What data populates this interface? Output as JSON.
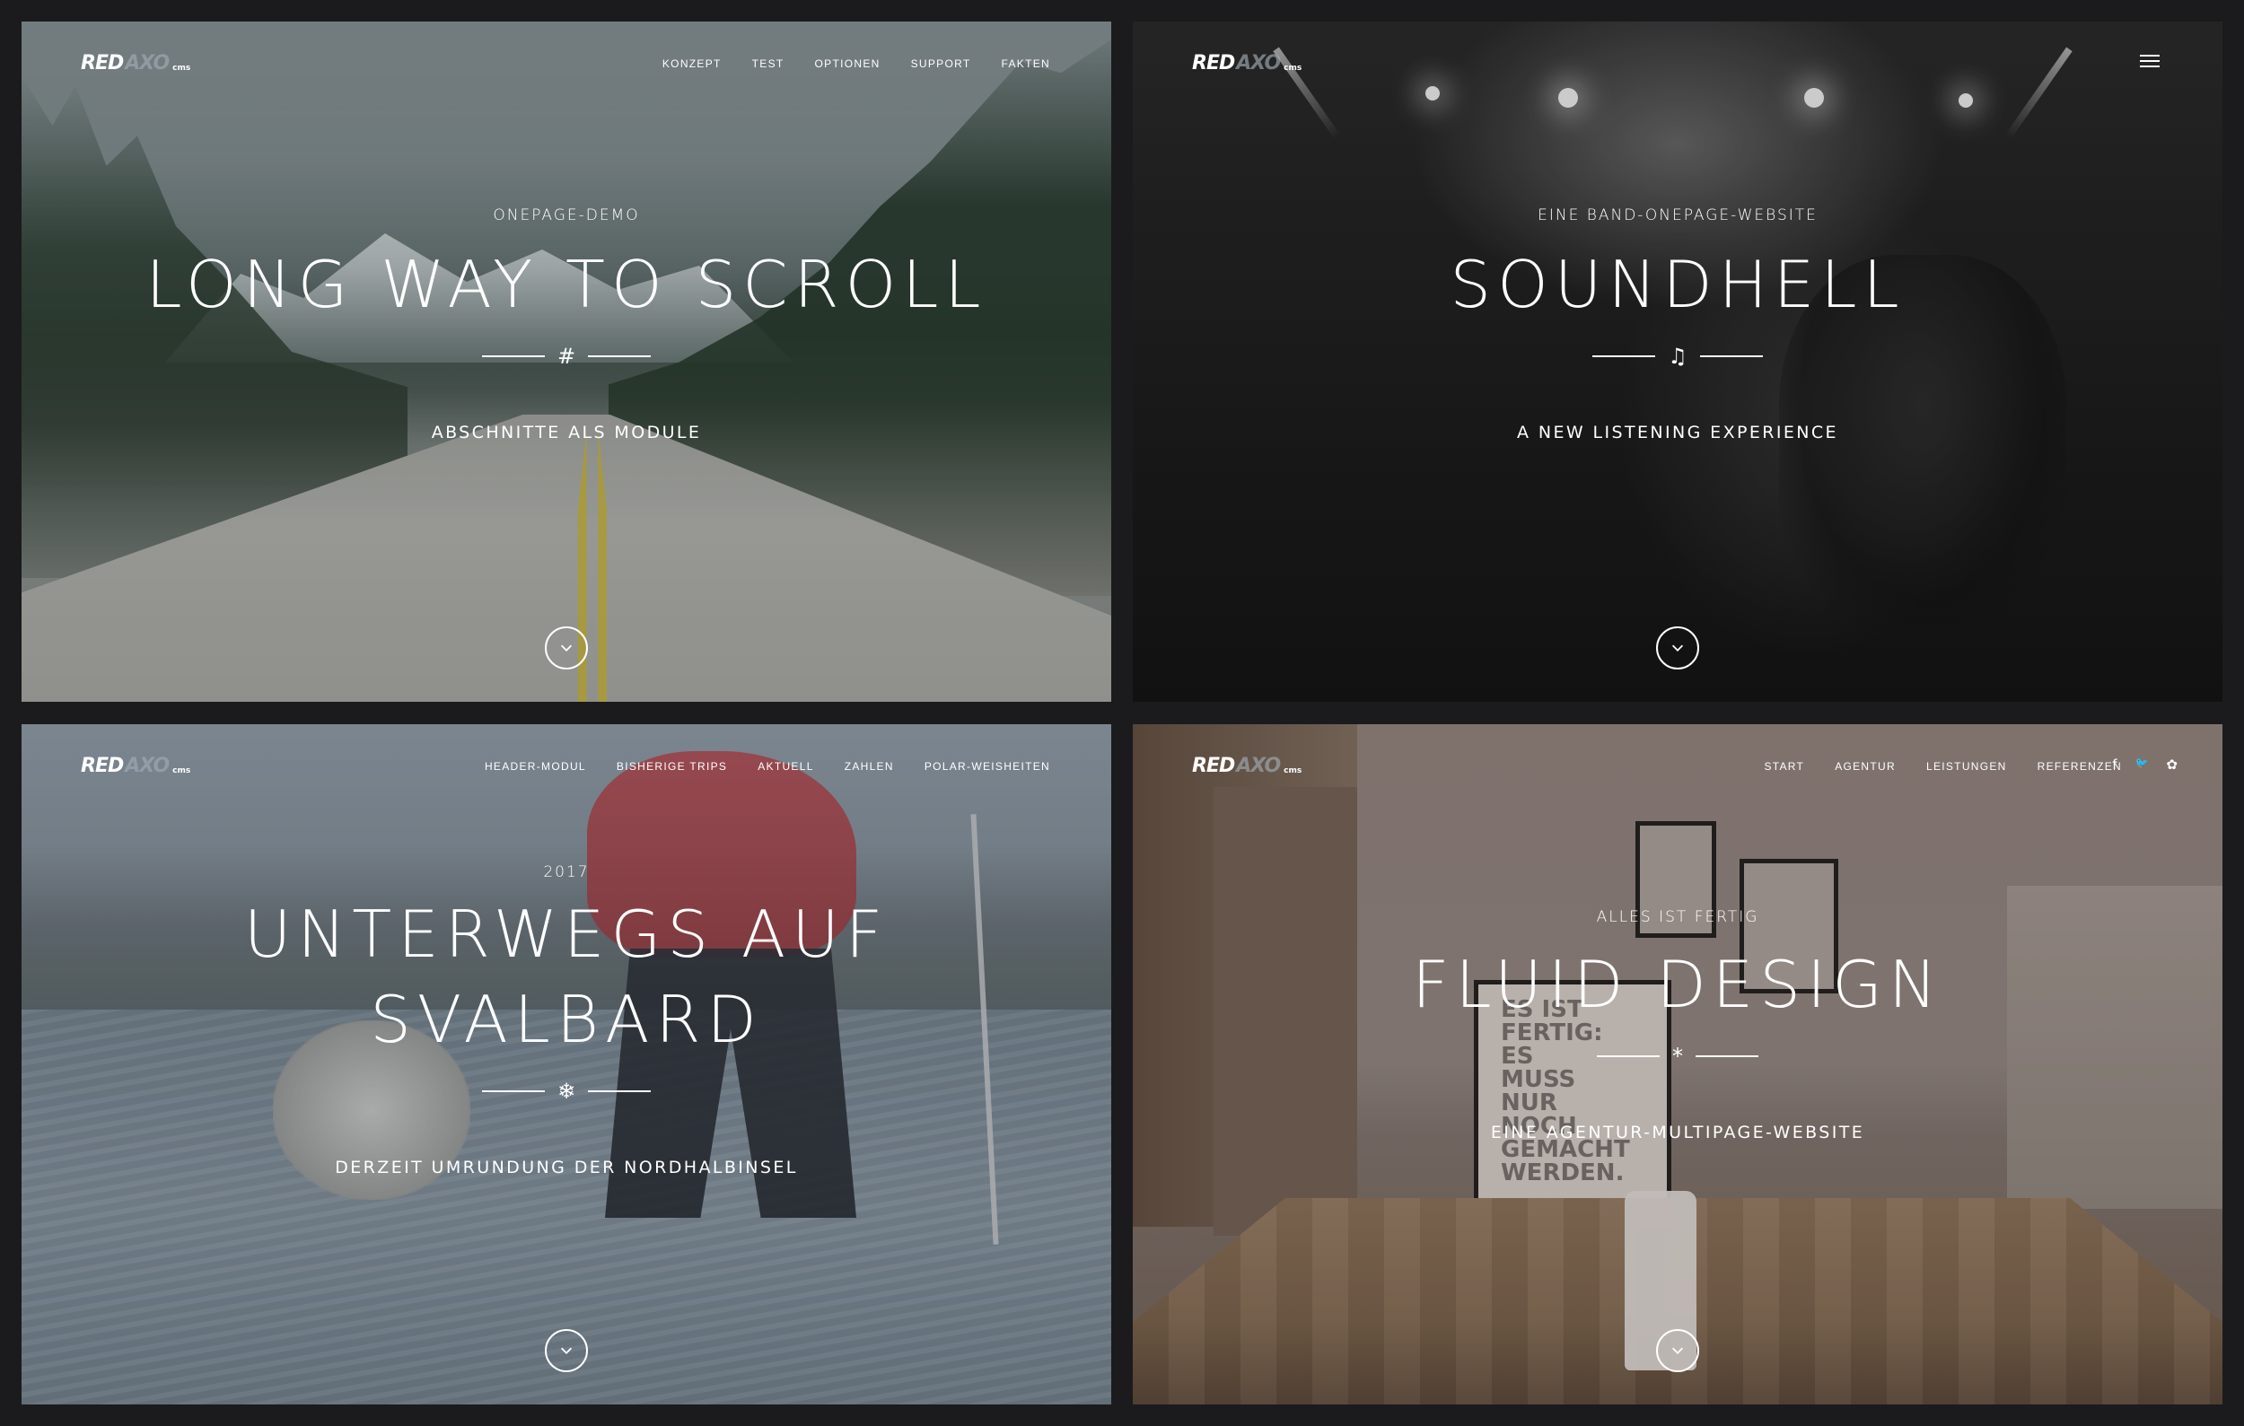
{
  "panels": [
    {
      "logo": {
        "red": "RED",
        "axo": "AXO",
        "cms": "cms"
      },
      "nav": [
        "KONZEPT",
        "TEST",
        "OPTIONEN",
        "SUPPORT",
        "FAKTEN"
      ],
      "eyebrow": "ONEPAGE-DEMO",
      "headline": [
        "LONG WAY TO SCROLL"
      ],
      "divider_glyph": "#",
      "tagline": "ABSCHNITTE ALS MODULE",
      "scroll_icon": "chevron-down-icon"
    },
    {
      "logo": {
        "red": "RED",
        "axo": "AXO",
        "cms": "cms"
      },
      "menu_icon": "hamburger-menu-icon",
      "eyebrow": "EINE BAND-ONEPAGE-WEBSITE",
      "headline": [
        "SOUNDHELL"
      ],
      "divider_glyph": "♫",
      "tagline": "A NEW LISTENING EXPERIENCE",
      "scroll_icon": "chevron-down-icon"
    },
    {
      "logo": {
        "red": "RED",
        "axo": "AXO",
        "cms": "cms"
      },
      "nav": [
        "HEADER-MODUL",
        "BISHERIGE TRIPS",
        "AKTUELL",
        "ZAHLEN",
        "POLAR-WEISHEITEN"
      ],
      "eyebrow": "2017",
      "headline": [
        "UNTERWEGS AUF",
        "SVALBARD"
      ],
      "divider_glyph": "❄",
      "tagline": "DERZEIT UMRUNDUNG DER NORDHALBINSEL",
      "scroll_icon": "chevron-down-icon"
    },
    {
      "logo": {
        "red": "RED",
        "axo": "AXO",
        "cms": "cms"
      },
      "nav": [
        "START",
        "AGENTUR",
        "LEISTUNGEN",
        "REFERENZEN"
      ],
      "social": [
        {
          "icon": "facebook-icon",
          "glyph": "f"
        },
        {
          "icon": "twitter-icon",
          "glyph": "🐦"
        },
        {
          "icon": "flower-icon",
          "glyph": "✿"
        }
      ],
      "poster_text": "ES IST FERTIG: ES MUSS NUR NOCH GEMACHT WERDEN.",
      "eyebrow": "ALLES IST FERTIG",
      "headline": [
        "FLUID DESIGN"
      ],
      "divider_glyph": "*",
      "tagline": "EINE AGENTUR-MULTIPAGE-WEBSITE",
      "scroll_icon": "chevron-down-icon"
    }
  ],
  "colors": {
    "page_bg": "#1b1b1d",
    "text": "#ffffff",
    "logo_axo": "#a0aab4"
  }
}
